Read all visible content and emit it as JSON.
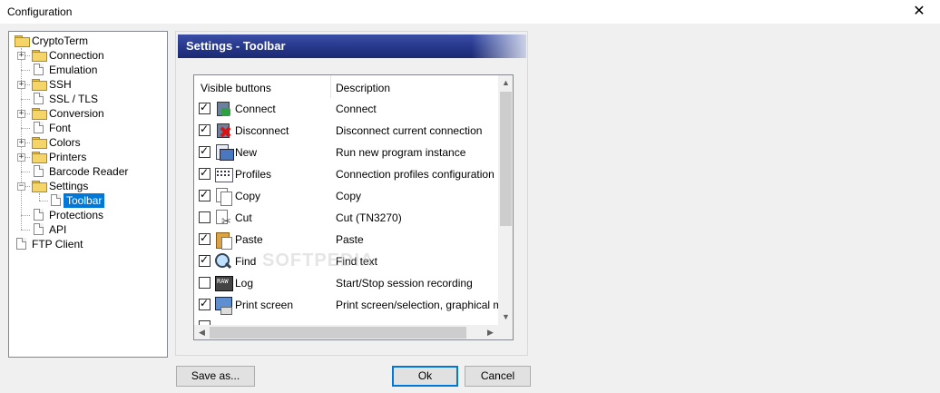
{
  "window": {
    "title": "Configuration",
    "close_glyph": "✕"
  },
  "tree": {
    "items": [
      {
        "label": "CryptoTerm",
        "icon": "folder-icon",
        "expander": ""
      },
      {
        "label": "Connection",
        "icon": "folder-icon",
        "expander": "+"
      },
      {
        "label": "Emulation",
        "icon": "document-icon",
        "expander": ""
      },
      {
        "label": "SSH",
        "icon": "folder-icon",
        "expander": "+"
      },
      {
        "label": "SSL / TLS",
        "icon": "document-icon",
        "expander": ""
      },
      {
        "label": "Conversion",
        "icon": "folder-icon",
        "expander": "+"
      },
      {
        "label": "Font",
        "icon": "document-icon",
        "expander": ""
      },
      {
        "label": "Colors",
        "icon": "folder-icon",
        "expander": "+"
      },
      {
        "label": "Printers",
        "icon": "folder-icon",
        "expander": "+"
      },
      {
        "label": "Barcode Reader",
        "icon": "document-icon",
        "expander": ""
      },
      {
        "label": "Settings",
        "icon": "folder-icon",
        "expander": "−"
      },
      {
        "label": "Toolbar",
        "icon": "document-icon",
        "expander": "",
        "selected": true
      },
      {
        "label": "Protections",
        "icon": "document-icon",
        "expander": ""
      },
      {
        "label": "API",
        "icon": "document-icon",
        "expander": ""
      },
      {
        "label": "FTP Client",
        "icon": "document-icon",
        "expander": ""
      }
    ]
  },
  "panel": {
    "header": "Settings - Toolbar",
    "columns": {
      "col1": "Visible buttons",
      "col2": "Description"
    },
    "rows": [
      {
        "name": "Connect",
        "desc": "Connect",
        "checked": true,
        "icon": "connect-icon"
      },
      {
        "name": "Disconnect",
        "desc": "Disconnect current connection",
        "checked": true,
        "icon": "disconnect-icon"
      },
      {
        "name": "New",
        "desc": "Run new program instance",
        "checked": true,
        "icon": "new-instance-icon"
      },
      {
        "name": "Profiles",
        "desc": "Connection profiles configuration",
        "checked": true,
        "icon": "profiles-icon"
      },
      {
        "name": "Copy",
        "desc": "Copy",
        "checked": true,
        "icon": "copy-icon"
      },
      {
        "name": "Cut",
        "desc": "Cut  (TN3270)",
        "checked": false,
        "icon": "cut-icon"
      },
      {
        "name": "Paste",
        "desc": "Paste",
        "checked": true,
        "icon": "paste-icon"
      },
      {
        "name": "Find",
        "desc": "Find text",
        "checked": true,
        "icon": "find-icon"
      },
      {
        "name": "Log",
        "desc": "Start/Stop session recording",
        "checked": false,
        "icon": "log-icon"
      },
      {
        "name": "Print screen",
        "desc": "Print screen/selection, graphical mo...",
        "checked": true,
        "icon": "print-screen-icon"
      }
    ],
    "watermark": "SOFTPEDIA"
  },
  "buttons": {
    "save_as": "Save as...",
    "ok": "Ok",
    "cancel": "Cancel"
  },
  "scroll": {
    "up": "▲",
    "down": "▼",
    "left": "◀",
    "right": "▶"
  }
}
